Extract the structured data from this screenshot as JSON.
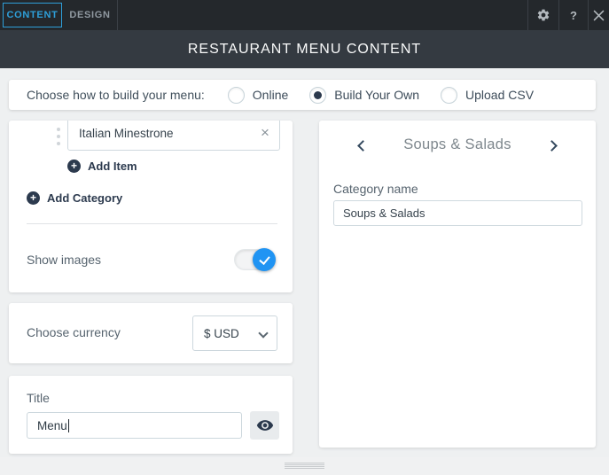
{
  "topbar": {
    "tabs": [
      {
        "label": "CONTENT",
        "active": true
      },
      {
        "label": "DESIGN",
        "active": false
      }
    ],
    "help_glyph": "?"
  },
  "header": {
    "title": "RESTAURANT MENU CONTENT"
  },
  "build_bar": {
    "label": "Choose how to build your menu:",
    "options": [
      {
        "label": "Online",
        "selected": false
      },
      {
        "label": "Build Your Own",
        "selected": true
      },
      {
        "label": "Upload CSV",
        "selected": false
      }
    ]
  },
  "menu_card": {
    "item_input_value": "Italian Minestrone",
    "clear_glyph": "×",
    "plus_glyph": "+",
    "add_item_label": "Add Item",
    "add_category_label": "Add Category",
    "show_images_label": "Show images",
    "show_images_on": true
  },
  "currency_card": {
    "label": "Choose currency",
    "selected_option": "$ USD"
  },
  "title_card": {
    "label": "Title",
    "value": "Menu"
  },
  "category_panel": {
    "title": "Soups & Salads",
    "name_label": "Category name",
    "name_value": "Soups & Salads"
  },
  "colors": {
    "accent_blue": "#2e9fd9",
    "toggle_blue": "#2094f3",
    "navy": "#2c3a4e",
    "topbar_bg": "#24282c",
    "header_bg": "#343a41",
    "page_bg": "#eef0f1"
  }
}
